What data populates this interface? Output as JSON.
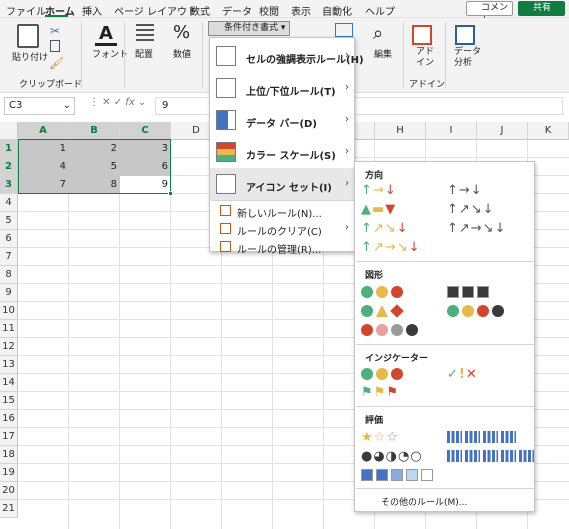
{
  "menubar": {
    "tabs": [
      "ファイル",
      "ホーム",
      "挿入",
      "ページ レイアウト",
      "数式",
      "データ",
      "校閲",
      "表示",
      "自動化",
      "ヘルプ"
    ],
    "comment": "コメント",
    "share": "共有"
  },
  "ribbon": {
    "paste": "貼り付け",
    "clipboard_group": "クリップボード",
    "font": "フォント",
    "align": "配置",
    "number": "数値",
    "percent": "%",
    "cond_format": "条件付き書式",
    "edit": "編集",
    "addin": "アド\nイン",
    "addin_group": "アドイン",
    "analysis": "データ\n分析"
  },
  "formula": {
    "namebox": "C3",
    "fx": "fx",
    "value": "9"
  },
  "columns": [
    "A",
    "B",
    "C",
    "D",
    "E",
    "F",
    "G",
    "H",
    "I",
    "J",
    "K"
  ],
  "rows": [
    "1",
    "2",
    "3",
    "4",
    "5",
    "6",
    "7",
    "8",
    "9",
    "10",
    "11",
    "12",
    "13",
    "14",
    "15",
    "16",
    "17",
    "18",
    "19",
    "20",
    "21"
  ],
  "cells": [
    [
      "1",
      "2",
      "3"
    ],
    [
      "4",
      "5",
      "6"
    ],
    [
      "7",
      "8",
      "9"
    ]
  ],
  "cf_menu": {
    "items": [
      {
        "label": "セルの強調表示ルール(H)"
      },
      {
        "label": "上位/下位ルール(T)"
      },
      {
        "label": "データ バー(D)"
      },
      {
        "label": "カラー スケール(S)"
      },
      {
        "label": "アイコン セット(I)"
      }
    ],
    "small_items": [
      "新しいルール(N)...",
      "ルールのクリア(C)",
      "ルールの管理(R)..."
    ]
  },
  "icon_sets": {
    "direction": "方向",
    "shapes": "図形",
    "indicators": "インジケーター",
    "ratings": "評価",
    "other": "その他のルール(M)..."
  },
  "colors": {
    "accent": "#107c41",
    "green": "#4caf7d",
    "yellow": "#e8b84a",
    "red": "#d2462d",
    "gray": "#555555"
  }
}
